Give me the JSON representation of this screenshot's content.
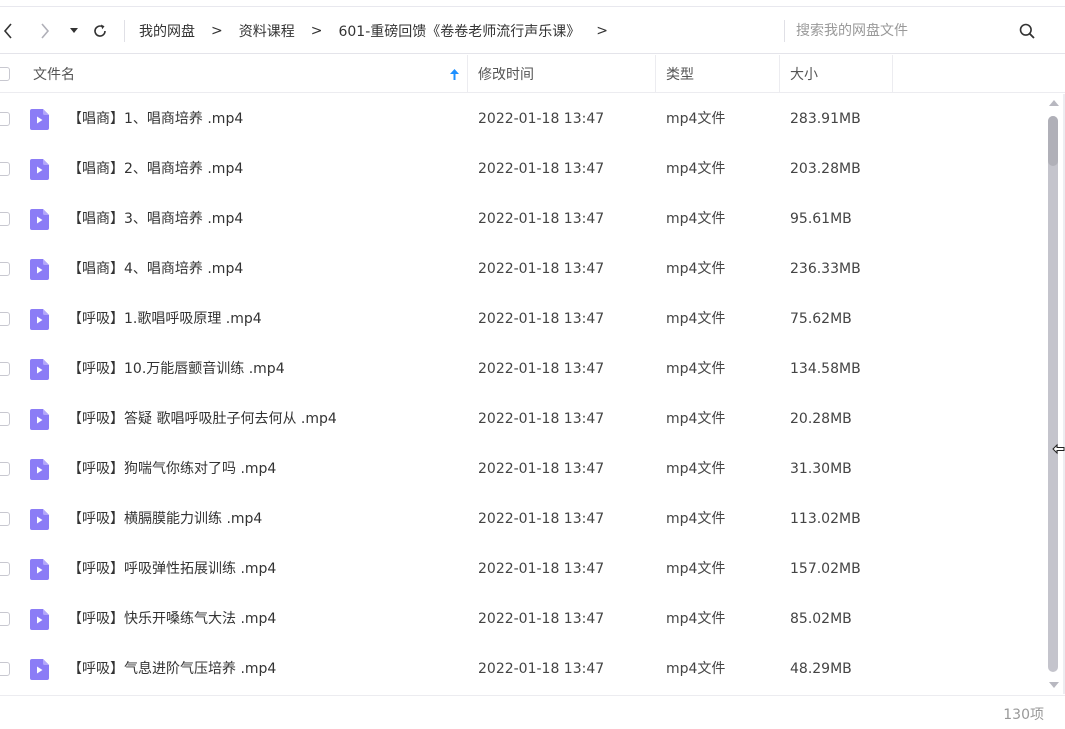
{
  "toolbar": {
    "breadcrumb": [
      "我的网盘",
      "资料课程",
      "601-重磅回馈《卷卷老师流行声乐课》"
    ],
    "separator": ">",
    "search_placeholder": "搜索我的网盘文件"
  },
  "header": {
    "name": "文件名",
    "modified": "修改时间",
    "type": "类型",
    "size": "大小"
  },
  "files": [
    {
      "name": "【唱商】1、唱商培养 .mp4",
      "modified": "2022-01-18 13:47",
      "type": "mp4文件",
      "size": "283.91MB"
    },
    {
      "name": "【唱商】2、唱商培养 .mp4",
      "modified": "2022-01-18 13:47",
      "type": "mp4文件",
      "size": "203.28MB"
    },
    {
      "name": "【唱商】3、唱商培养 .mp4",
      "modified": "2022-01-18 13:47",
      "type": "mp4文件",
      "size": "95.61MB"
    },
    {
      "name": "【唱商】4、唱商培养 .mp4",
      "modified": "2022-01-18 13:47",
      "type": "mp4文件",
      "size": "236.33MB"
    },
    {
      "name": "【呼吸】1.歌唱呼吸原理 .mp4",
      "modified": "2022-01-18 13:47",
      "type": "mp4文件",
      "size": "75.62MB"
    },
    {
      "name": "【呼吸】10.万能唇颤音训练 .mp4",
      "modified": "2022-01-18 13:47",
      "type": "mp4文件",
      "size": "134.58MB"
    },
    {
      "name": "【呼吸】答疑 歌唱呼吸肚子何去何从 .mp4",
      "modified": "2022-01-18 13:47",
      "type": "mp4文件",
      "size": "20.28MB"
    },
    {
      "name": "【呼吸】狗喘气你练对了吗 .mp4",
      "modified": "2022-01-18 13:47",
      "type": "mp4文件",
      "size": "31.30MB"
    },
    {
      "name": "【呼吸】横膈膜能力训练 .mp4",
      "modified": "2022-01-18 13:47",
      "type": "mp4文件",
      "size": "113.02MB"
    },
    {
      "name": "【呼吸】呼吸弹性拓展训练 .mp4",
      "modified": "2022-01-18 13:47",
      "type": "mp4文件",
      "size": "157.02MB"
    },
    {
      "name": "【呼吸】快乐开嗓练气大法 .mp4",
      "modified": "2022-01-18 13:47",
      "type": "mp4文件",
      "size": "85.02MB"
    },
    {
      "name": "【呼吸】气息进阶气压培养 .mp4",
      "modified": "2022-01-18 13:47",
      "type": "mp4文件",
      "size": "48.29MB"
    }
  ],
  "footer": {
    "count": "130项"
  },
  "colors": {
    "file_icon": "#8b7cf6",
    "sort_arrow": "#1e90ff"
  }
}
